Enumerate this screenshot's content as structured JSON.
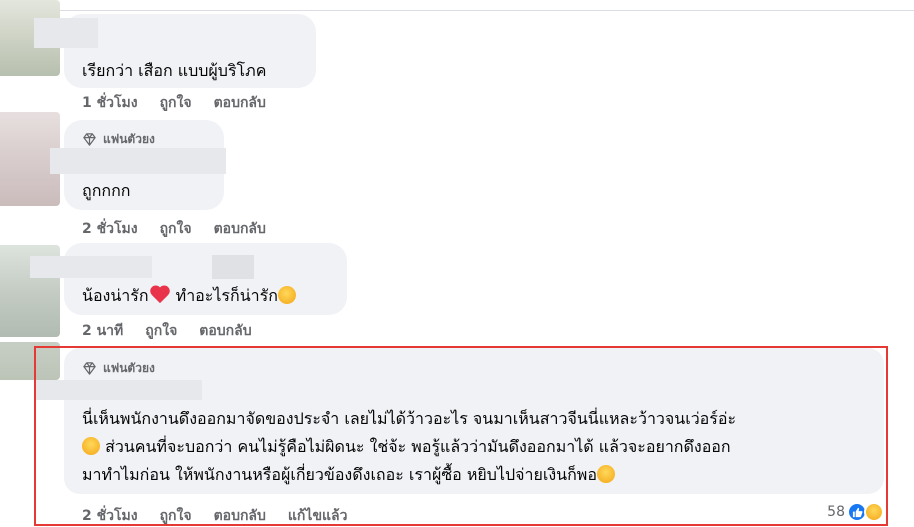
{
  "comments": [
    {
      "text_lines": [
        "เรียกว่า เสือก แบบผู้บริโภค"
      ],
      "time": "1 ชั่วโมง",
      "like_label": "ถูกใจ",
      "reply_label": "ตอบกลับ"
    },
    {
      "badge": "แฟนตัวยง",
      "text_lines": [
        "ถูกกกก"
      ],
      "time": "2 ชั่วโมง",
      "like_label": "ถูกใจ",
      "reply_label": "ตอบกลับ"
    },
    {
      "text_prefix": "น้องน่ารัก",
      "text_suffix": " ทำอะไรก็น่ารัก",
      "time": "2 นาที",
      "like_label": "ถูกใจ",
      "reply_label": "ตอบกลับ"
    },
    {
      "badge": "แฟนตัวยง",
      "line1": "นี่เห็นพนักงานดึงออกมาจัดของประจำ เลยไม่ได้ว้าวอะไร จนมาเห็นสาวจีนนี่แหละว้าวจนเว่อร์อ่ะ",
      "line2": "ส่วนคนที่จะบอกว่า คนไม่รู้คือไม่ผิดนะ ใช่จ้ะ พอรู้แล้วว่ามันดึงออกมาได้ แล้วจะอยากดึงออก",
      "line3": "มาทำไมก่อน ให้พนักงานหรือผู้เกี่ยวข้องดึงเถอะ เราผู้ซื้อ หยิบไปจ่ายเงินก็พอ",
      "time": "2 ชั่วโมง",
      "like_label": "ถูกใจ",
      "reply_label": "ตอบกลับ",
      "edited_label": "แก้ไขแล้ว",
      "reaction_count": "58",
      "reactions": [
        "like-icon",
        "haha-icon"
      ]
    }
  ],
  "colors": {
    "bubble": "#f0f2f5",
    "muted": "#65676b",
    "highlight": "#e53935",
    "like": "#1877f2"
  }
}
